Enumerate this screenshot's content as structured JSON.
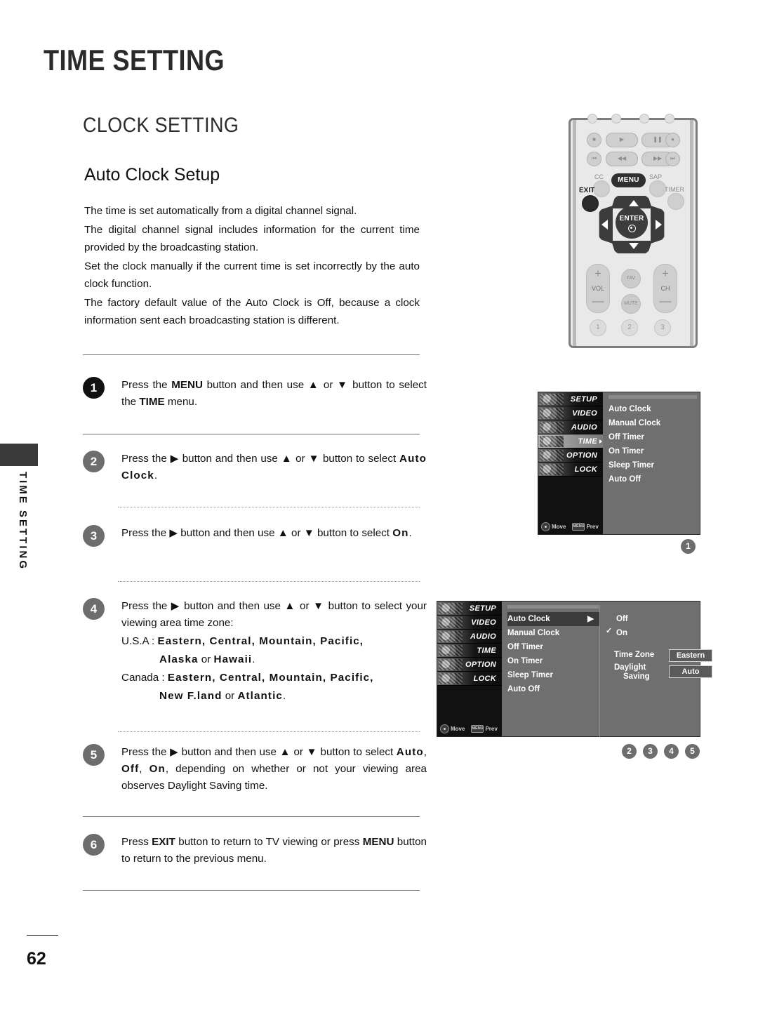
{
  "page": {
    "title": "TIME SETTING",
    "section": "CLOCK SETTING",
    "subsection": "Auto Clock Setup",
    "side_tab": "TIME SETTING",
    "page_number": "62"
  },
  "intro": {
    "p1": "The time is set automatically from a digital channel signal.",
    "p2": "The digital channel signal includes information for the current time provided by the broadcasting station.",
    "p3": "Set the clock manually if the current time is set incorrectly by the auto clock function.",
    "p4": "The factory default value of the Auto Clock is Off, because a clock information sent each broadcasting station is different."
  },
  "steps": [
    {
      "number": "1",
      "pre": "Press the ",
      "b1": "MENU",
      "mid": " button and then use ▲ or ▼ button to select the ",
      "b2": "TIME",
      "post": " menu."
    },
    {
      "number": "2",
      "pre": "Press the ▶ button and then use ▲ or ▼ button to select ",
      "b1": "Auto Clock",
      "post": "."
    },
    {
      "number": "3",
      "pre": "Press the ▶ button and then use ▲ or ▼ button to select ",
      "b1": "On",
      "post": "."
    },
    {
      "number": "4",
      "pre": "Press the ▶ button and then use ▲ or ▼ button to select your viewing area time zone:",
      "usa_label": "U.S.A : ",
      "usa_zones": "Eastern, Central, Mountain, Pacific,",
      "usa_zones2": "Alaska",
      "usa_or": " or ",
      "usa_zones3": "Hawaii",
      "usa_end": ".",
      "canada_label": "Canada : ",
      "canada_zones": "Eastern, Central, Mountain, Pacific,",
      "canada_zones2": "New F.land",
      "canada_or": " or ",
      "canada_zones3": "Atlantic",
      "canada_end": "."
    },
    {
      "number": "5",
      "pre": "Press the ▶ button and then use ▲ or ▼ button to select ",
      "b1": "Auto",
      "sep1": ", ",
      "b2": "Off",
      "sep2": ", ",
      "b3": "On",
      "post": ", depending on whether or not your viewing area observes Daylight Saving time."
    },
    {
      "number": "6",
      "pre": "Press ",
      "b1": "EXIT",
      "mid": " button to return to TV viewing or press ",
      "b2": "MENU",
      "post": " button to return to the previous menu."
    }
  ],
  "remote": {
    "transport_row1": [
      "stop-icon",
      "play-icon",
      "pause-icon",
      "record-icon"
    ],
    "transport_row2": [
      "skip-back-icon",
      "rewind-icon",
      "fast-forward-icon",
      "skip-forward-icon"
    ],
    "cc_label": "CC",
    "sap_label": "SAP",
    "timer_label": "TIMER",
    "exit_label": "EXIT",
    "menu_label": "MENU",
    "enter_label": "ENTER",
    "vol_label": "VOL",
    "ch_label": "CH",
    "fav_label": "FAV",
    "mute_label": "MUTE",
    "plus": "+",
    "minus": "—",
    "num1": "1",
    "num2": "2",
    "num3": "3"
  },
  "osd1": {
    "sidebar": [
      "SETUP",
      "VIDEO",
      "AUDIO",
      "TIME",
      "OPTION",
      "LOCK"
    ],
    "active_index": 3,
    "items": [
      "Auto Clock",
      "Manual Clock",
      "Off Timer",
      "On Timer",
      "Sleep Timer",
      "Auto Off"
    ],
    "footer_move": "Move",
    "footer_prev": "Prev",
    "step_badges": [
      "1"
    ]
  },
  "osd2": {
    "sidebar": [
      "SETUP",
      "VIDEO",
      "AUDIO",
      "TIME",
      "OPTION",
      "LOCK"
    ],
    "items": [
      "Auto Clock",
      "Manual Clock",
      "Off Timer",
      "On Timer",
      "Sleep Timer",
      "Auto Off"
    ],
    "selected_item": "Auto Clock",
    "options": [
      "Off",
      "On"
    ],
    "checked_option": "On",
    "timezone_label": "Time Zone",
    "timezone_value": "Eastern",
    "daylight_label_1": "Daylight",
    "daylight_label_2": "Saving",
    "daylight_value": "Auto",
    "footer_move": "Move",
    "footer_prev": "Prev",
    "step_badges": [
      "2",
      "3",
      "4",
      "5"
    ]
  }
}
